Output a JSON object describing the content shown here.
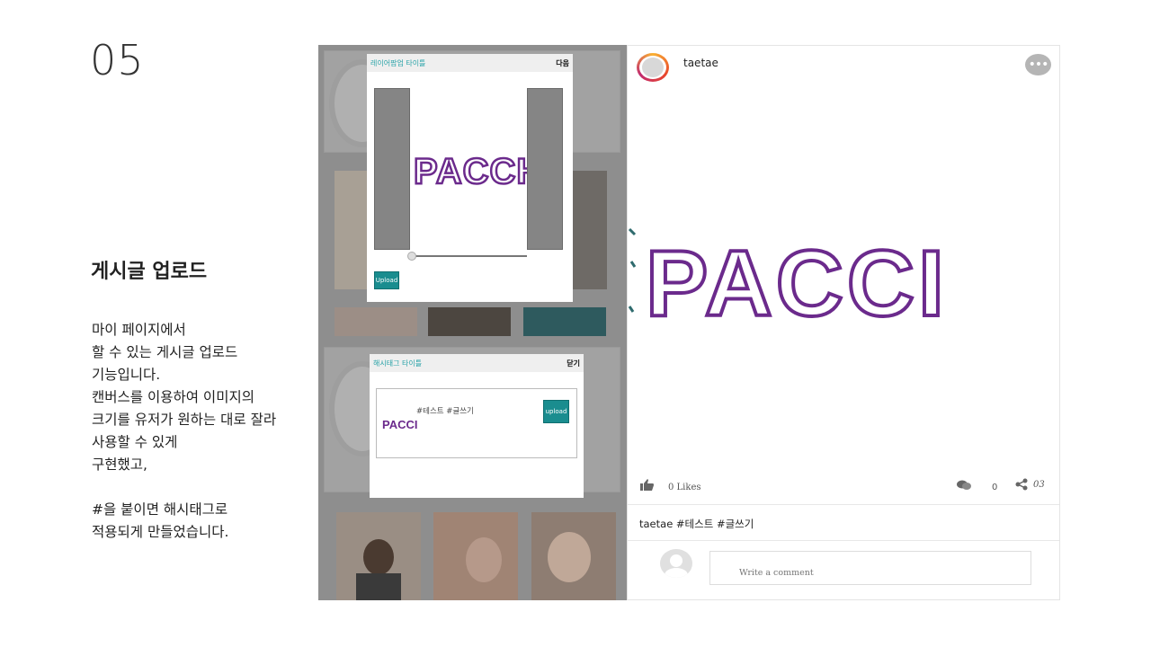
{
  "slide": {
    "number": "05",
    "title": "게시글 업로드",
    "description": "마이 페이지에서\n할 수 있는 게시글 업로드\n기능입니다.\n캔버스를 이용하여 이미지의\n크기를 유저가 원하는 대로 잘라\n사용할 수 있게\n구현했고,\n\n#을 붙이면 해시태그로\n적용되게 만들었습니다."
  },
  "crop_popup": {
    "title": "레이어팝업 타이틀",
    "action": "다음",
    "logo_text": "PACCH",
    "upload_label": "Upload"
  },
  "hashtag_popup": {
    "title": "해시태그 타이틀",
    "action": "닫기",
    "hashtags": "#테스트 #글쓰기",
    "logo_text": "PACCI",
    "upload_label": "upload"
  },
  "post": {
    "username": "taetae",
    "image_text": "PACCI",
    "likes": "0 Likes",
    "comment_count": "0",
    "share_count": "03",
    "caption": "taetae #테스트 #글쓰기",
    "comment_placeholder": "Write a comment"
  },
  "colors": {
    "teal": "#1a8d8f",
    "title_teal": "#2aa3a8",
    "brand_purple": "#6b2a8c"
  }
}
